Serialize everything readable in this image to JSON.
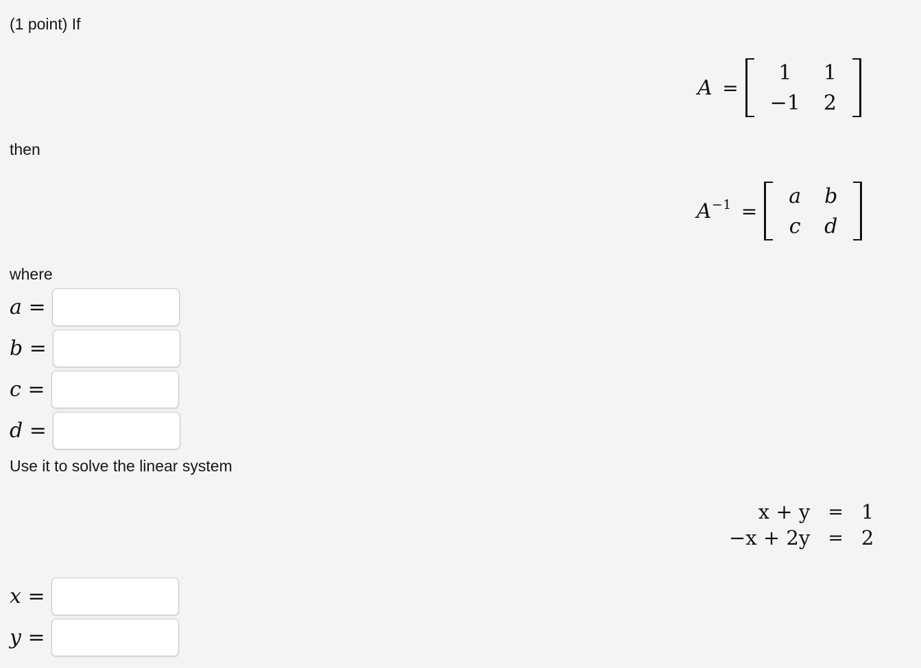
{
  "problem": {
    "points_text": "(1 point) If",
    "then_text": "then",
    "where_text": "where",
    "use_it_text": "Use it to solve the linear system"
  },
  "matrix_a": {
    "label": "A",
    "equals": "=",
    "rows": [
      [
        "1",
        "1"
      ],
      [
        "−1",
        "2"
      ]
    ]
  },
  "matrix_a_inverse": {
    "label": "A",
    "exponent": "−1",
    "equals": "=",
    "rows": [
      [
        "a",
        "b"
      ],
      [
        "c",
        "d"
      ]
    ]
  },
  "answers": [
    {
      "label": "a",
      "equals": "=",
      "value": "",
      "placeholder": ""
    },
    {
      "label": "b",
      "equals": "=",
      "value": "",
      "placeholder": ""
    },
    {
      "label": "c",
      "equals": "=",
      "value": "",
      "placeholder": ""
    },
    {
      "label": "d",
      "equals": "=",
      "value": "",
      "placeholder": ""
    }
  ],
  "system": {
    "equations": [
      {
        "lhs": "x + y",
        "eq": "=",
        "rhs": "1"
      },
      {
        "lhs": "−x + 2y",
        "eq": "=",
        "rhs": "2"
      }
    ]
  },
  "solution_answers": [
    {
      "label": "x",
      "equals": "=",
      "value": "",
      "placeholder": ""
    },
    {
      "label": "y",
      "equals": "=",
      "value": "",
      "placeholder": ""
    }
  ],
  "colors": {
    "page_background": "#f4f4f4",
    "input_background": "#ffffff",
    "input_border": "#c9c9c9",
    "text": "#161616"
  }
}
